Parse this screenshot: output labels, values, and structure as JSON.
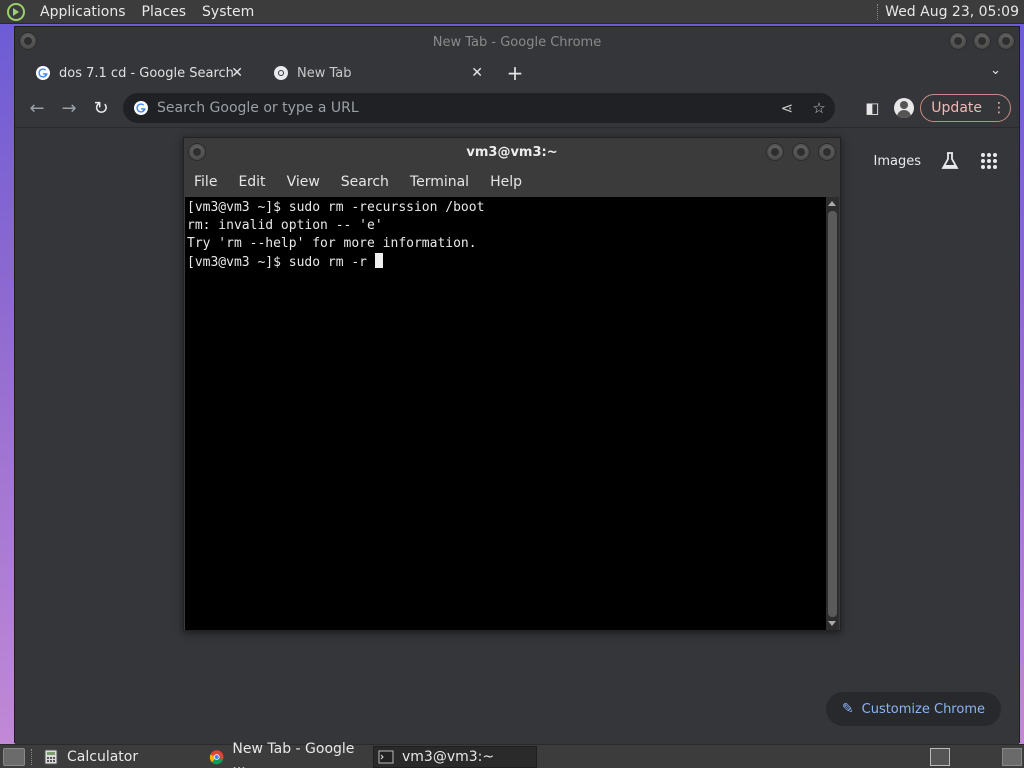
{
  "top_panel": {
    "menus": [
      "Applications",
      "Places",
      "System"
    ],
    "clock": "Wed Aug 23, 05:09"
  },
  "chrome": {
    "window_title": "New Tab - Google Chrome",
    "tabs": [
      {
        "label": "dos 7.1 cd - Google Search",
        "icon": "google-icon"
      },
      {
        "label": "New Tab",
        "icon": "chrome-icon"
      }
    ],
    "omnibox_placeholder": "Search Google or type a URL",
    "update_label": "Update",
    "ntp": {
      "images_link": "Images",
      "customize_label": "Customize Chrome"
    }
  },
  "terminal": {
    "title": "vm3@vm3:~",
    "menus": [
      "File",
      "Edit",
      "View",
      "Search",
      "Terminal",
      "Help"
    ],
    "lines": [
      "[vm3@vm3 ~]$ sudo rm -recurssion /boot",
      "rm: invalid option -- 'e'",
      "Try 'rm --help' for more information.",
      "[vm3@vm3 ~]$ sudo rm -r "
    ]
  },
  "bottom_panel": {
    "tasks": [
      {
        "label": "Calculator",
        "icon": "calculator-icon"
      },
      {
        "label": "New Tab - Google ...",
        "icon": "chrome-icon"
      },
      {
        "label": "vm3@vm3:~",
        "icon": "terminal-icon",
        "active": true
      }
    ]
  }
}
